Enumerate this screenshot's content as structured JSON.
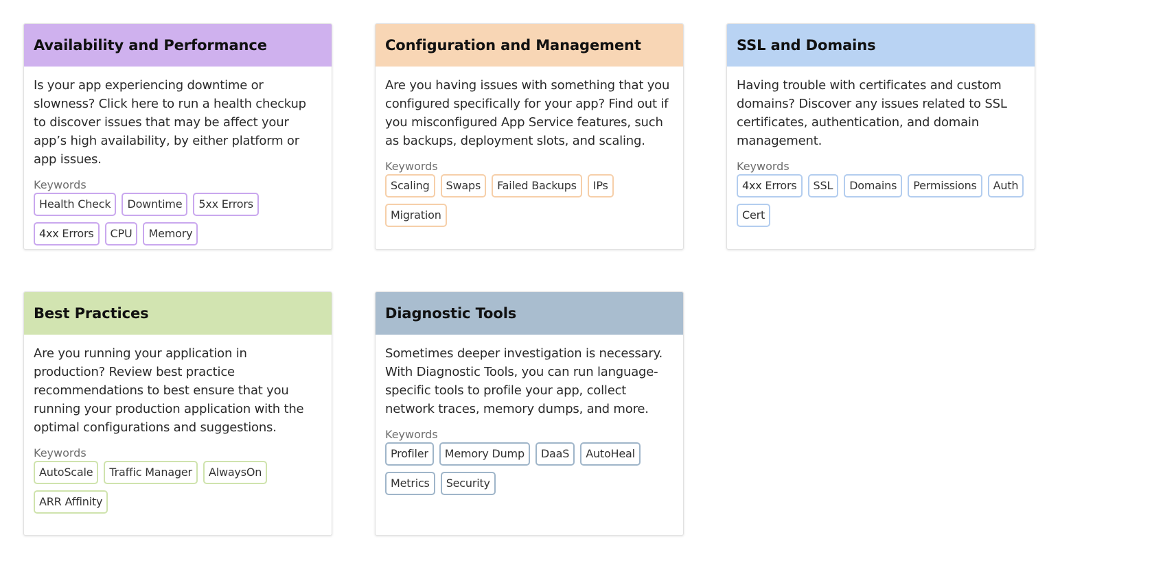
{
  "keywords_label": "Keywords",
  "cards": [
    {
      "title": "Availability and Performance",
      "description": "Is your app experiencing downtime or slowness? Click here to run a health checkup to discover issues that may be affect your app’s high availability, by either platform or app issues.",
      "keywords": [
        "Health Check",
        "Downtime",
        "5xx Errors",
        "4xx Errors",
        "CPU",
        "Memory"
      ],
      "color": "#cfb1ee"
    },
    {
      "title": "Configuration and Management",
      "description": "Are you having issues with something that you configured specifically for your app? Find out if you misconfigured App Service features, such as backups, deployment slots, and scaling.",
      "keywords": [
        "Scaling",
        "Swaps",
        "Failed Backups",
        "IPs",
        "Migration"
      ],
      "color": "#f8d6b5"
    },
    {
      "title": "SSL and Domains",
      "description": "Having trouble with certificates and custom domains? Discover any issues related to SSL certificates, authentication, and domain management.",
      "keywords": [
        "4xx Errors",
        "SSL",
        "Domains",
        "Permissions",
        "Auth",
        "Cert"
      ],
      "color": "#b9d3f3"
    },
    {
      "title": "Best Practices",
      "description": "Are you running your application in production? Review best practice recommendations to best ensure that you running your production application with the optimal configurations and suggestions.",
      "keywords": [
        "AutoScale",
        "Traffic Manager",
        "AlwaysOn",
        "ARR Affinity"
      ],
      "color": "#d2e4b1"
    },
    {
      "title": "Diagnostic Tools",
      "description": "Sometimes deeper investigation is necessary. With Diagnostic Tools, you can run language-specific tools to profile your app, collect network traces, memory dumps, and more.",
      "keywords": [
        "Profiler",
        "Memory Dump",
        "DaaS",
        "AutoHeal",
        "Metrics",
        "Security"
      ],
      "color": "#a9bdcf"
    }
  ]
}
